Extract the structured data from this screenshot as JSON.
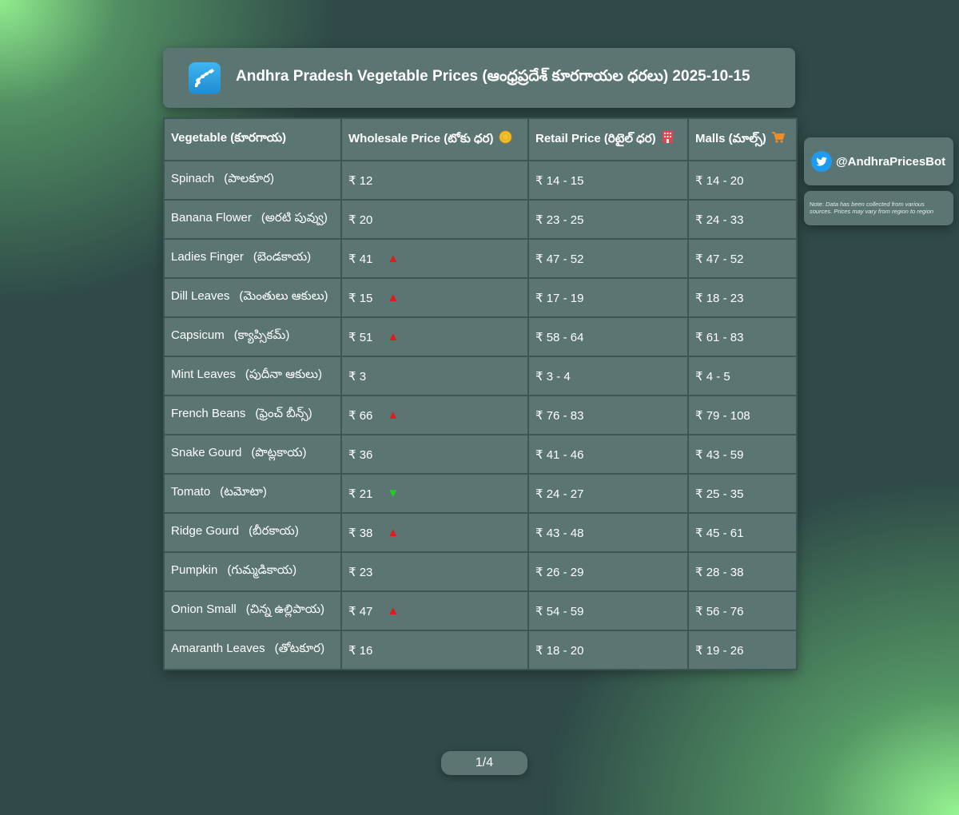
{
  "header": {
    "title": "Andhra Pradesh Vegetable Prices (ఆంధ్రప్రదేశ్ కూరగాయల ధరలు) 2025-10-15",
    "logo_icon": "andhra-pradesh-map-icon"
  },
  "table": {
    "columns": [
      {
        "label": "Vegetable (కూరగాయ)",
        "icon": ""
      },
      {
        "label": "Wholesale Price (టోకు ధర)",
        "icon": "coin-icon"
      },
      {
        "label": "Retail Price (రిటైల్ ధర)",
        "icon": "building-icon"
      },
      {
        "label": "Malls (మాల్స్)",
        "icon": "shopping-cart-icon"
      }
    ],
    "rows": [
      {
        "name": "Spinach",
        "name_te": "(పాలకూర)",
        "wholesale": "₹ 12",
        "trend": "",
        "retail": "₹ 14 - 15",
        "malls": "₹ 14 - 20"
      },
      {
        "name": "Banana Flower",
        "name_te": "(అరటి పువ్వు)",
        "wholesale": "₹ 20",
        "trend": "",
        "retail": "₹ 23 - 25",
        "malls": "₹ 24 - 33"
      },
      {
        "name": "Ladies Finger",
        "name_te": "(బెండకాయ)",
        "wholesale": "₹ 41",
        "trend": "up",
        "retail": "₹ 47 - 52",
        "malls": "₹ 47 - 52"
      },
      {
        "name": "Dill Leaves",
        "name_te": "(మెంతులు ఆకులు)",
        "wholesale": "₹ 15",
        "trend": "up",
        "retail": "₹ 17 - 19",
        "malls": "₹ 18 - 23"
      },
      {
        "name": "Capsicum",
        "name_te": "(క్యాప్సికమ్)",
        "wholesale": "₹ 51",
        "trend": "up",
        "retail": "₹ 58 - 64",
        "malls": "₹ 61 - 83"
      },
      {
        "name": "Mint Leaves",
        "name_te": "(పుదీనా ఆకులు)",
        "wholesale": "₹ 3",
        "trend": "",
        "retail": "₹ 3 - 4",
        "malls": "₹ 4 - 5"
      },
      {
        "name": "French Beans",
        "name_te": "(ఫ్రెంచ్ బీన్స్)",
        "wholesale": "₹ 66",
        "trend": "up",
        "retail": "₹ 76 - 83",
        "malls": "₹ 79 - 108"
      },
      {
        "name": "Snake Gourd",
        "name_te": "(పొట్లకాయ)",
        "wholesale": "₹ 36",
        "trend": "",
        "retail": "₹ 41 - 46",
        "malls": "₹ 43 - 59"
      },
      {
        "name": "Tomato",
        "name_te": "(టమోటా)",
        "wholesale": "₹ 21",
        "trend": "down",
        "retail": "₹ 24 - 27",
        "malls": "₹ 25 - 35"
      },
      {
        "name": "Ridge Gourd",
        "name_te": "(బీరకాయ)",
        "wholesale": "₹ 38",
        "trend": "up",
        "retail": "₹ 43 - 48",
        "malls": "₹ 45 - 61"
      },
      {
        "name": "Pumpkin",
        "name_te": "(గుమ్మడికాయ)",
        "wholesale": "₹ 23",
        "trend": "",
        "retail": "₹ 26 - 29",
        "malls": "₹ 28 - 38"
      },
      {
        "name": "Onion Small",
        "name_te": "(చిన్న ఉల్లిపాయ)",
        "wholesale": "₹ 47",
        "trend": "up",
        "retail": "₹ 54 - 59",
        "malls": "₹ 56 - 76"
      },
      {
        "name": "Amaranth Leaves",
        "name_te": "(తోటకూర)",
        "wholesale": "₹ 16",
        "trend": "",
        "retail": "₹ 18 - 20",
        "malls": "₹ 19 - 26"
      }
    ]
  },
  "sidebar": {
    "handle_icon": "twitter-bird-icon",
    "handle": "@AndhraPricesBot",
    "note_label": "Note:",
    "note_text": "Data has been collected from various sources. Prices may vary from region to region"
  },
  "pager": {
    "label": "1/4"
  },
  "colors": {
    "panel": "#5b7572",
    "background": "#2f4a48",
    "glow": "#96f591",
    "trend_up": "#e11b1b",
    "trend_down": "#1fd11f",
    "twitter": "#1d9bf0"
  }
}
